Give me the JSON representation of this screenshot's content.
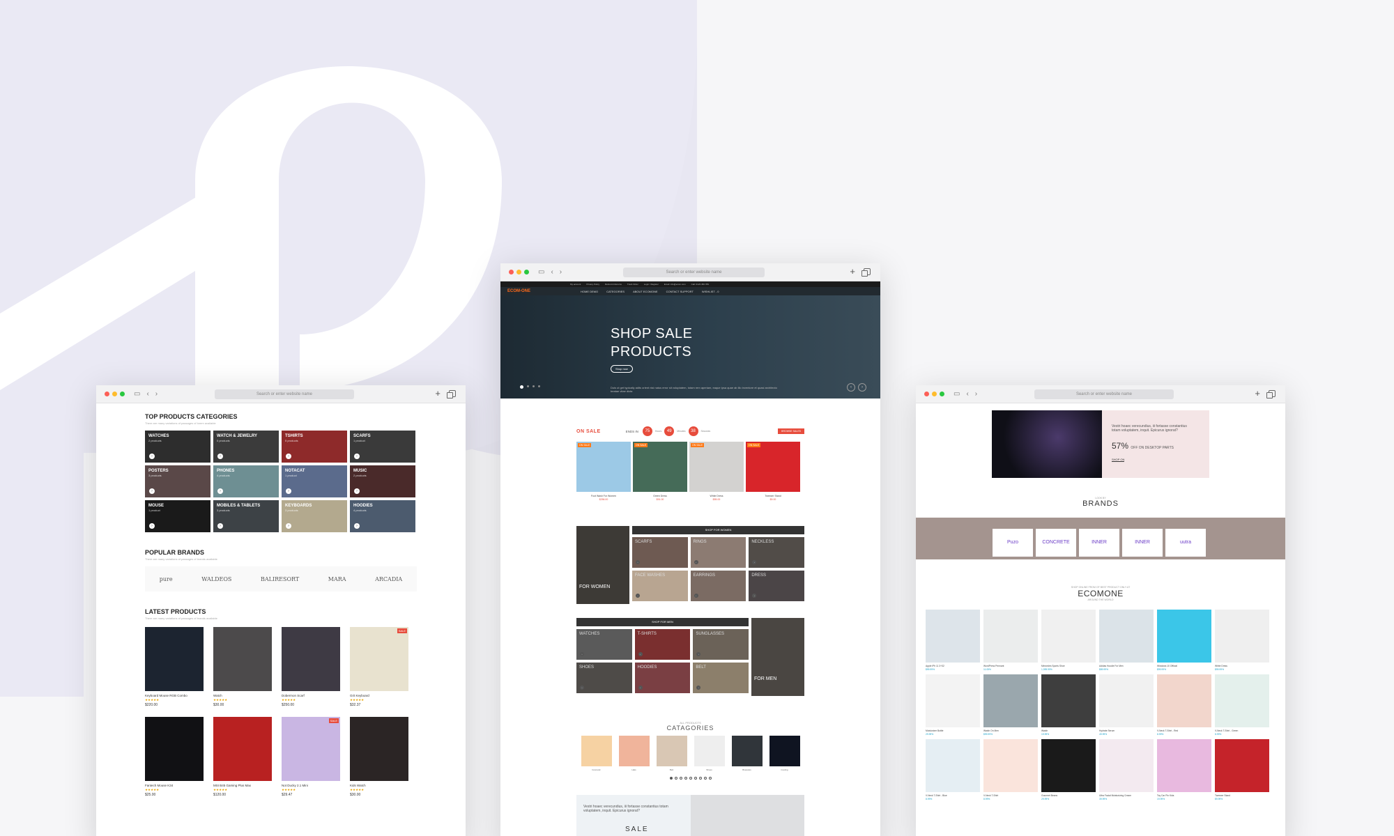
{
  "browser": {
    "url_placeholder": "Search or enter website name"
  },
  "left": {
    "categories_title": "TOP PRODUCTS CATEGORIES",
    "categories_sub": "There are many variations of passages of lorem available",
    "categories": [
      {
        "name": "WATCHES",
        "count": "2 products",
        "color": "#2d2d2d"
      },
      {
        "name": "WATCH & JEWELRY",
        "count": "0 products",
        "color": "#3b3b3b"
      },
      {
        "name": "TSHIRTS",
        "count": "5 products",
        "color": "#8e2a2a"
      },
      {
        "name": "SCARFS",
        "count": "1 product",
        "color": "#3a3a3a"
      },
      {
        "name": "POSTERS",
        "count": "3 products",
        "color": "#5a4848"
      },
      {
        "name": "PHONES",
        "count": "4 products",
        "color": "#6e8f93"
      },
      {
        "name": "NOTACAT",
        "count": "1 product",
        "color": "#5b6b8c"
      },
      {
        "name": "MUSIC",
        "count": "2 products",
        "color": "#4a2a2a"
      },
      {
        "name": "MOUSE",
        "count": "1 product",
        "color": "#1a1a1a"
      },
      {
        "name": "MOBILES & TABLETS",
        "count": "3 products",
        "color": "#3d4246"
      },
      {
        "name": "KEYBOARDS",
        "count": "3 products",
        "color": "#b3a98e"
      },
      {
        "name": "HOODIES",
        "count": "4 products",
        "color": "#4c5b6e"
      }
    ],
    "brands_title": "POPULAR BRANDS",
    "brands_sub": "There are many variations of passages of brands available",
    "brands": [
      "pure",
      "WALDEOS",
      "BALIRESORT",
      "MARA",
      "ARCADIA"
    ],
    "latest_title": "LATEST PRODUCTS",
    "latest_sub": "There are many variations of passages of brands available",
    "products": [
      {
        "name": "Keyboard Mouse RGB Combo",
        "price": "$220.00",
        "color": "#1c2430",
        "sale": ""
      },
      {
        "name": "Watch",
        "price": "$30.00",
        "color": "#4c4a4b",
        "sale": ""
      },
      {
        "name": "Dobermon Scarf",
        "price": "$250.00",
        "color": "#3e3a44",
        "sale": ""
      },
      {
        "name": "Grit Keyboard",
        "price": "$32.37",
        "color": "#e8e2cf",
        "sale": "SALE"
      },
      {
        "name": "Fantech Mouse K34",
        "price": "$25.00",
        "color": "#111114",
        "sale": ""
      },
      {
        "name": "MSI B45 Gaming Plus Max",
        "price": "$120.00",
        "color": "#b82121",
        "sale": ""
      },
      {
        "name": "Not Ducky 2.1 Mini",
        "price": "$29.47",
        "color": "#c9b6e3",
        "sale": "SALE"
      },
      {
        "name": "Kids Watch",
        "price": "$30.00",
        "color": "#2b2525",
        "sale": ""
      }
    ]
  },
  "center": {
    "topbar": [
      "My account",
      "Privacy Policy",
      "Refund & Returns",
      "Track Order",
      "Login / Register",
      "Email: info@ecom.com",
      "Call: 0123 456 789"
    ],
    "brand": "ECOM-ONE",
    "nav": [
      "HOME DEMO",
      "CATEGORIES",
      "ABOUT ECOMONE",
      "CONTACT SUPPORT",
      "WISHLIST - 0"
    ],
    "hero_title_1": "SHOP SALE",
    "hero_title_2": "PRODUCTS",
    "hero_btn": "Shop now",
    "hero_desc": "Duis ut get typically adits orient nisi natus error sit voluptatem, totam rem aperiam, eaque ipsa quae ab illo inventore et quasi architecto beatae vitae dicta",
    "onsale": "ON SALE",
    "ends_in": "ENDS IN",
    "countdown": [
      {
        "v": "75",
        "l": "Hours"
      },
      {
        "v": "49",
        "l": "Minutes"
      },
      {
        "v": "38",
        "l": "Seconds"
      }
    ],
    "browse_btn": "BROWSE SALES",
    "sale_items": [
      {
        "name": "Foot Wash For Women",
        "price": "$256.00",
        "tag": "ON SALE",
        "color": "#9cc9e6"
      },
      {
        "name": "Green Dress",
        "price": "$91.00",
        "tag": "ON SALE",
        "color": "#456b58"
      },
      {
        "name": "White Dress",
        "price": "$55.00",
        "tag": "ON SALE",
        "color": "#d3d2d0"
      },
      {
        "name": "Tweezer Stand",
        "price": "$9.00",
        "tag": "ON SALE",
        "color": "#d8252a"
      }
    ],
    "women_title": "SHOP FOR WOMEN",
    "women_big": "FOR WOMEN",
    "women": [
      "SCARFS",
      "RINGS",
      "NECKLESS",
      "FACE WASHES",
      "EARRINGS",
      "DRESS"
    ],
    "men_title": "SHOP FOR MEN",
    "men_big": "FOR MEN",
    "men": [
      "WATCHES",
      "T-SHIRTS",
      "SUNGLASSES",
      "SHOES",
      "HOODIES",
      "BELT"
    ],
    "allcat_sub": "ALL PRODUCTS",
    "allcat_title": "CATAGORIES",
    "cats": [
      {
        "name": "Cosmetic",
        "color": "#f6d2a3"
      },
      {
        "name": "Hats",
        "color": "#f0b49b"
      },
      {
        "name": "Belt",
        "color": "#d9c7b4"
      },
      {
        "name": "Shoes",
        "color": "#eeeeee"
      },
      {
        "name": "Bracelets",
        "color": "#30353a"
      },
      {
        "name": "Cooling",
        "color": "#0f1421"
      }
    ],
    "bottom_text": "Vestri hoaec verecundius, iii fortasse constantius totam voluptatem, inquit. Epicurus ignorat?",
    "bottom_sale": "SALE"
  },
  "right": {
    "banner_q": "Vestri hoaec verecundius, iii fortasse constantius totam voluptatem, inquit. Epicurus ignorat?",
    "banner_pct": "57%",
    "banner_off": "OFF ON DESKTOP PARTS",
    "banner_shop": "SHOP ON",
    "brands_sub": "LOOK BY",
    "brands_title": "BRANDS",
    "brands": [
      "Puzo",
      "CONCRETE",
      "INNER",
      "INNER",
      "uutra"
    ],
    "eco_sub": "SHOP ONLINE FROM OF BEST PRODUCT ONLY AT",
    "eco_title": "ECOMONE",
    "eco_sub2": "AROUND THE WORLD",
    "products": [
      {
        "name": "Apple iPh 11 3+32",
        "price": "$99.99%",
        "color": "#dde4ea"
      },
      {
        "name": "WordPress Pennant",
        "price": "11.05%",
        "color": "#ebeded"
      },
      {
        "name": "Mercedes Sports Shoe",
        "price": "1,999.99%",
        "color": "#f0f0f0"
      },
      {
        "name": "Adidas Hoodie For Men",
        "price": "$89.99%",
        "color": "#dbe3e8"
      },
      {
        "name": "Windows 10 Official",
        "price": "$99.99%",
        "color": "#3bc6e8"
      },
      {
        "name": "White Dress",
        "price": "$99.99%",
        "color": "#efefef"
      },
      {
        "name": "Moisturizer Bottle",
        "price": "29.99%",
        "color": "#f3f3f3"
      },
      {
        "name": "Watch On Men",
        "price": "$99.99%",
        "color": "#9aa7ad"
      },
      {
        "name": "Watch",
        "price": "19.99%",
        "color": "#3e3e3e"
      },
      {
        "name": "Hydrate Serum",
        "price": "49.99%",
        "color": "#f1f1f1"
      },
      {
        "name": "V-Neck T-Shirt - Red",
        "price": "8.99%",
        "color": "#f2d6cc"
      },
      {
        "name": "V-Neck T-Shirt - Green",
        "price": "8.99%",
        "color": "#e4f0ec"
      },
      {
        "name": "V-Neck T-Shirt - Blue",
        "price": "8.99%",
        "color": "#e5eef3"
      },
      {
        "name": "V-Neck T-Shirt",
        "price": "8.99%",
        "color": "#fae4dc"
      },
      {
        "name": "Gourmet Beans",
        "price": "29.99%",
        "color": "#1a1a1a"
      },
      {
        "name": "Ultra Facial Moisturizing Cream",
        "price": "39.99%",
        "color": "#f3eaf0"
      },
      {
        "name": "Toy Car Pin Kids",
        "price": "19.99%",
        "color": "#e8b9df"
      },
      {
        "name": "Tweezer Stand",
        "price": "$9.99%",
        "color": "#c5232a"
      }
    ]
  }
}
